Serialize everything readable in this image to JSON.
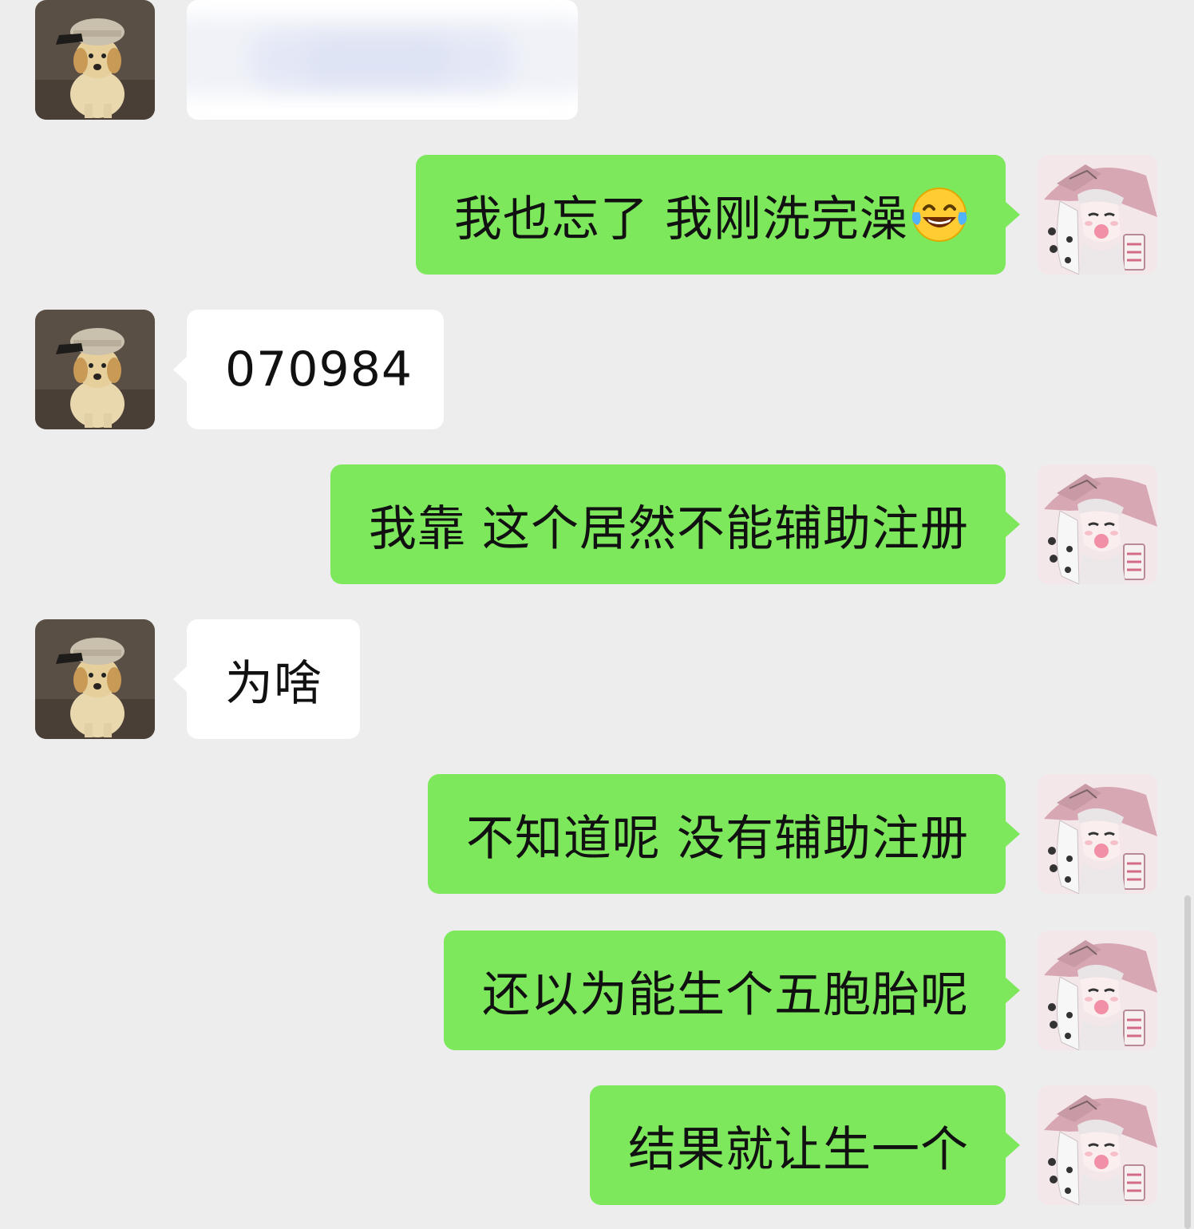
{
  "messages": [
    {
      "side": "in",
      "text": "",
      "redacted": true
    },
    {
      "side": "out",
      "text": "我也忘了 我刚洗完澡",
      "emoji": "tears-of-joy-emoji"
    },
    {
      "side": "in",
      "text": "070984"
    },
    {
      "side": "out",
      "text": "我靠 这个居然不能辅助注册"
    },
    {
      "side": "in",
      "text": "为啥"
    },
    {
      "side": "out",
      "text": "不知道呢 没有辅助注册"
    },
    {
      "side": "out",
      "text": "还以为能生个五胞胎呢"
    },
    {
      "side": "out",
      "text": "结果就让生一个"
    }
  ],
  "avatars": {
    "contact": "dog-with-cap-avatar",
    "self": "anime-girl-witch-hat-avatar"
  },
  "colors": {
    "background": "#ededed",
    "incoming_bubble": "#ffffff",
    "outgoing_bubble": "#7ee85c",
    "text": "#111111"
  }
}
